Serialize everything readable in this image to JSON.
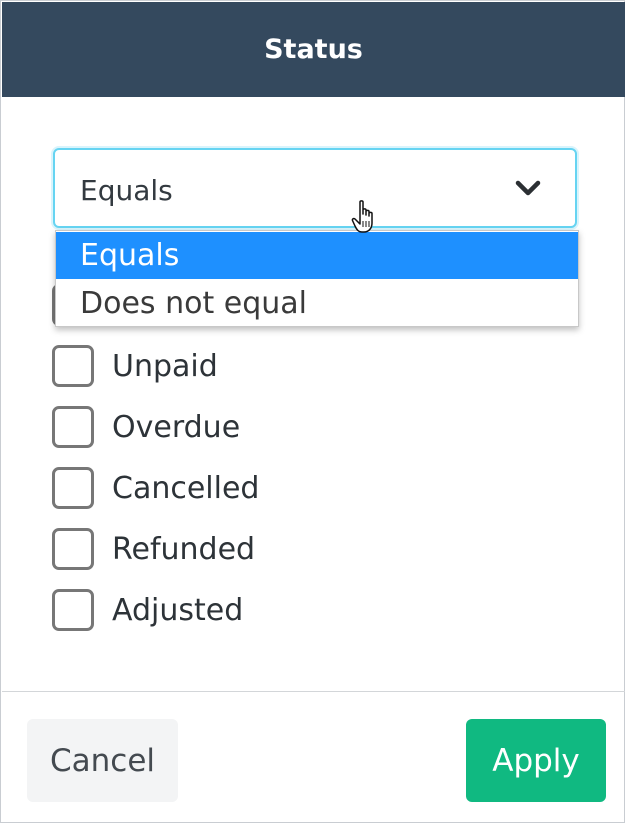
{
  "header": {
    "title": "Status"
  },
  "select": {
    "value": "Equals",
    "chevron_icon": "chevron-down-icon",
    "options": [
      {
        "label": "Equals",
        "selected": true
      },
      {
        "label": "Does not equal",
        "selected": false
      }
    ]
  },
  "checkboxes": [
    {
      "label": "Unpaid",
      "checked": false
    },
    {
      "label": "Overdue",
      "checked": false
    },
    {
      "label": "Cancelled",
      "checked": false
    },
    {
      "label": "Refunded",
      "checked": false
    },
    {
      "label": "Adjusted",
      "checked": false
    }
  ],
  "footer": {
    "cancel_label": "Cancel",
    "apply_label": "Apply"
  },
  "colors": {
    "header_bg": "#34495e",
    "select_focus_border": "#66d4f2",
    "option_highlight": "#1e90ff",
    "apply_bg": "#10b981"
  }
}
